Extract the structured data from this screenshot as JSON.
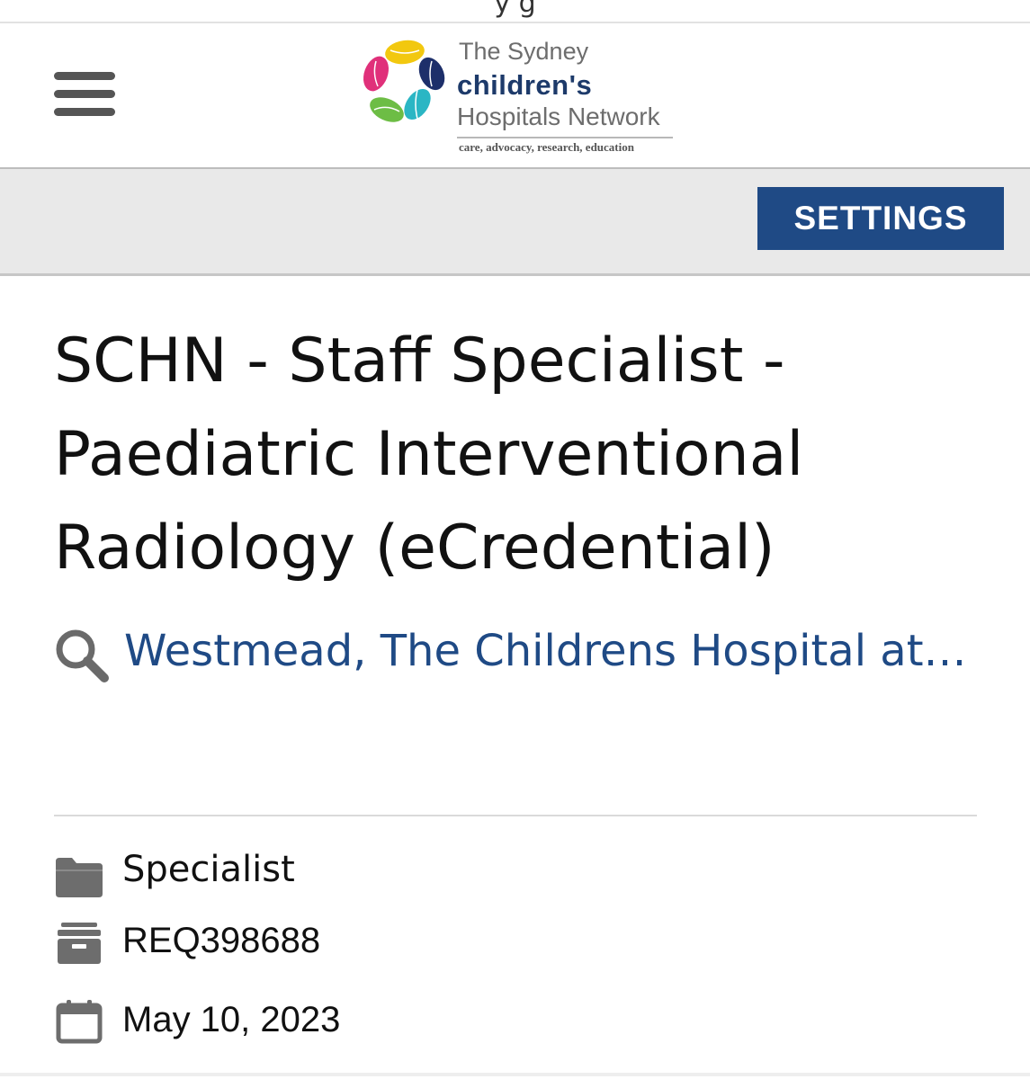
{
  "top_strip": {
    "partial_text": "y g"
  },
  "header": {
    "logo": {
      "line1": "The Sydney",
      "line2": "children's",
      "line3": "Hospitals Network",
      "tagline": "care, advocacy, research, education",
      "colors": [
        "#e0307a",
        "#f2c80f",
        "#1d2f6a",
        "#6dbd45",
        "#2bb6c4"
      ]
    },
    "menu_icon": "hamburger-icon"
  },
  "toolbar": {
    "settings_label": "SETTINGS",
    "accent": "#1f4a85"
  },
  "job": {
    "title": "SCHN - Staff Specialist - Paediatric Interventional Radiology (eCredential)",
    "location": "Westmead, The Childrens Hospital at W…",
    "location_icon": "search-icon",
    "category": "Specialist",
    "category_icon": "folder-icon",
    "requisition": "REQ398688",
    "requisition_icon": "archive-box-icon",
    "posted_date": "May 10, 2023",
    "date_icon": "calendar-icon"
  }
}
